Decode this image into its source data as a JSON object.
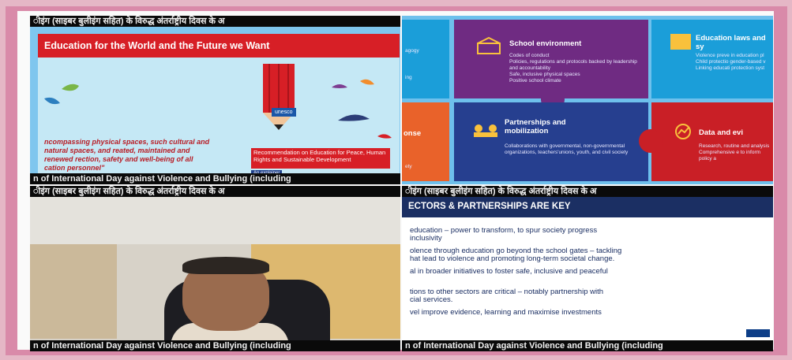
{
  "ticker": {
    "hindi": "ीइंग (साइबर बुलीइंग सहित) के विरुद्ध अंतर्राष्ट्रीय दिवस के अ",
    "english": "n of International Day against Violence and Bullying (including",
    "hindi_right": "ीइंग (साइबर बुलीइंग सहित) के विरुद्ध अंतर्राष्ट्रीय दिवस के अ",
    "english_right": "n of International Day against Violence and Bullying (including"
  },
  "pane1": {
    "title": "Education for the World and the Future we Want",
    "quote": "ncompassing physical spaces, such cultural and natural spaces, and reated, maintained and renewed rection, safety and well-being of all cation personnel\"",
    "unesco": "unesco",
    "recommendation": "Recommendation on Education for Peace, Human Rights and Sustainable Development",
    "explainer": "An explainer"
  },
  "pane2": {
    "left1": "agogy",
    "left1b": "ing",
    "school_title": "School environment",
    "school_items": [
      "Codes of conduct",
      "Policies, regulations and protocols backed by leadership and accountability",
      "Safe, inclusive physical spaces",
      "Positive school climate"
    ],
    "edu_title": "Education laws and sy",
    "edu_items": [
      "Violence preve in education pl",
      "Child protectio gender-based v",
      "Linking educati protection syst"
    ],
    "left2": "onse",
    "left2b": "ety",
    "partner_title": "Partnerships and mobilization",
    "partner_items": [
      "Collaborations with governmental, non-governmental organizations, teachers'unions, youth, and civil society"
    ],
    "data_title": "Data and evi",
    "data_items": [
      "Research, routine and analysis",
      "Comprehensive e to inform policy a"
    ]
  },
  "pane4": {
    "header": "ECTORS & PARTNERSHIPS ARE KEY",
    "lines": [
      "education – power to transform, to spur society progress",
      "inclusivity",
      "olence through education go beyond the school gates – tackling",
      "hat lead to violence and promoting long-term societal change.",
      "al in broader initiatives to foster safe, inclusive and peaceful",
      "tions to other sectors are critical – notably partnership with",
      "cial services.",
      "vel improve evidence, learning and maximise investments"
    ]
  }
}
